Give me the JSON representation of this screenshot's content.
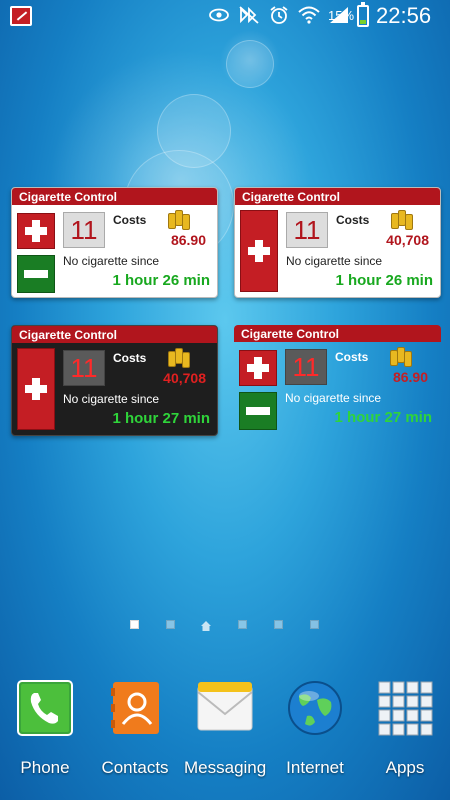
{
  "status_bar": {
    "battery_percent": "15%",
    "time": "22:56",
    "icons": [
      "app-notification-icon",
      "eye-icon",
      "mute-icon",
      "alarm-icon",
      "wifi-icon",
      "signal-icon",
      "battery-icon"
    ]
  },
  "widgets": [
    {
      "style": "light",
      "title": "Cigarette Control",
      "count": "11",
      "costs_label": "Costs",
      "cost_value": "86.90",
      "since_label": "No cigarette since",
      "since_value": "1 hour 26 min"
    },
    {
      "style": "light-tall",
      "title": "Cigarette Control",
      "count": "11",
      "costs_label": "Costs",
      "cost_value": "40,708",
      "since_label": "No cigarette since",
      "since_value": "1 hour 26 min"
    },
    {
      "style": "dark",
      "title": "Cigarette Control",
      "count": "11",
      "costs_label": "Costs",
      "cost_value": "40,708",
      "since_label": "No cigarette since",
      "since_value": "1 hour 27 min"
    },
    {
      "style": "transparent",
      "title": "Cigarette Control",
      "count": "11",
      "costs_label": "Costs",
      "cost_value": "86.90",
      "since_label": "No cigarette since",
      "since_value": "1 hour 27 min"
    }
  ],
  "pager": {
    "pages": 6,
    "active_index": 0,
    "home_index": 2
  },
  "dock": [
    {
      "label": "Phone",
      "icon": "phone-icon"
    },
    {
      "label": "Contacts",
      "icon": "contacts-icon"
    },
    {
      "label": "Messaging",
      "icon": "messaging-icon"
    },
    {
      "label": "Internet",
      "icon": "internet-globe-icon"
    },
    {
      "label": "Apps",
      "icon": "apps-grid-icon"
    }
  ],
  "colors": {
    "widget_header": "#b1151d",
    "plus_red": "#c41e24",
    "minus_green": "#1a7d24",
    "since_green": "#18a81f",
    "cost_red": "#c41e24"
  }
}
